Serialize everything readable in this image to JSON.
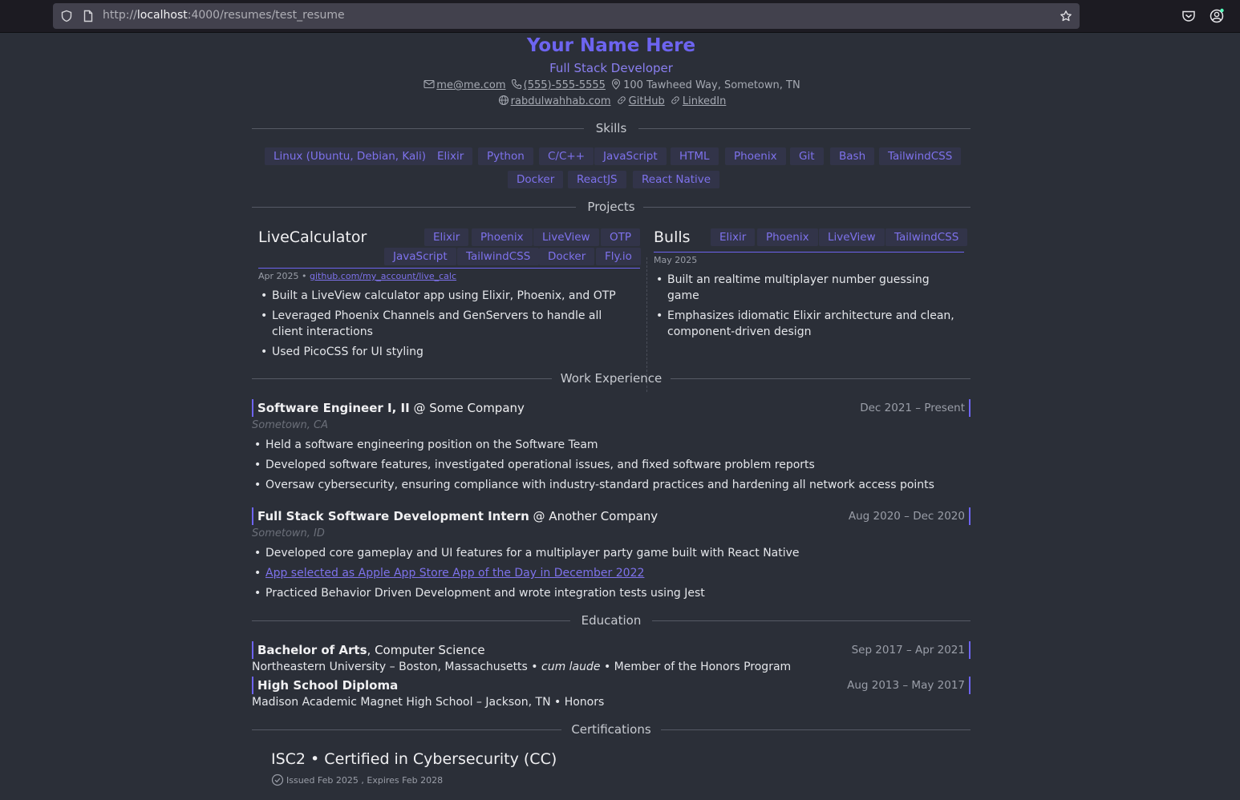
{
  "browser": {
    "url_prefix": "http://",
    "url_host": "localhost",
    "url_path": ":4000/resumes/test_resume"
  },
  "header": {
    "name": "Your Name Here",
    "role": "Full Stack Developer",
    "email": "me@me.com",
    "phone": "(555)-555-5555",
    "address": "100 Tawheed Way, Sometown, TN",
    "website": "rabdulwahhab.com",
    "github": "GitHub",
    "linkedin": "LinkedIn"
  },
  "sections": {
    "skills": "Skills",
    "projects": "Projects",
    "work": "Work Experience",
    "education": "Education",
    "certifications": "Certifications"
  },
  "skills": [
    "Linux (Ubuntu, Debian, Kali)",
    "Elixir",
    "Python",
    "C/C++",
    "JavaScript",
    "HTML",
    "Phoenix",
    "Git",
    "Bash",
    "TailwindCSS",
    "Docker",
    "ReactJS",
    "React Native"
  ],
  "projects": [
    {
      "title": "LiveCalculator",
      "tags": [
        "Elixir",
        "Phoenix",
        "LiveView",
        "OTP",
        "JavaScript",
        "TailwindCSS",
        "Docker",
        "Fly.io"
      ],
      "date": "Apr 2025",
      "sep": " • ",
      "link": "github.com/my_account/live_calc",
      "bullets": [
        "Built a LiveView calculator app using Elixir, Phoenix, and OTP",
        "Leveraged Phoenix Channels and GenServers to handle all client interactions",
        "Used PicoCSS for UI styling"
      ]
    },
    {
      "title": "Bulls",
      "tags": [
        "Elixir",
        "Phoenix",
        "LiveView",
        "TailwindCSS"
      ],
      "date": "May 2025",
      "bullets": [
        "Built an realtime multiplayer number guessing game",
        "Emphasizes idiomatic Elixir architecture and clean, component-driven design"
      ]
    }
  ],
  "jobs": [
    {
      "title": "Software Engineer I, II",
      "company": " @ Some Company",
      "dates": "Dec 2021 – Present",
      "location": "Sometown, CA",
      "bullets": [
        "Held a software engineering position on the Software Team",
        "Developed software features, investigated operational issues, and fixed software problem reports",
        "Oversaw cybersecurity, ensuring compliance with industry-standard practices and hardening all network access points"
      ]
    },
    {
      "title": "Full Stack Software Development Intern",
      "company": " @ Another Company",
      "dates": "Aug 2020 – Dec 2020",
      "location": "Sometown, ID",
      "bullets": [
        "Developed core gameplay and UI features for a multiplayer party game built with React Native",
        "App selected as Apple App Store App of the Day in December 2022",
        "Practiced Behavior Driven Development and wrote integration tests using Jest"
      ]
    }
  ],
  "education": [
    {
      "degree": "Bachelor of Arts",
      "field": ", Computer Science",
      "dates": "Sep 2017 – Apr 2021",
      "school": "Northeastern University – Boston, Massachusetts • ",
      "honor": "cum laude",
      "extra": " • Member of the Honors Program"
    },
    {
      "degree": "High School Diploma",
      "dates": "Aug 2013 – May 2017",
      "school": "Madison Academic Magnet High School – Jackson, TN • Honors"
    }
  ],
  "certification": {
    "title": "ISC2 • Certified in Cybersecurity (CC)",
    "issued": "Issued Feb 2025 , Expires Feb 2028"
  }
}
